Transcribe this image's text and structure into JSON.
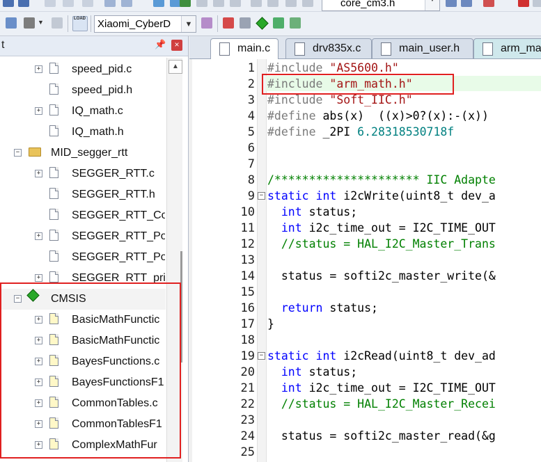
{
  "toolbar": {
    "file_combo": "core_cm3.h",
    "target_combo": "Xiaomi_CyberD",
    "load_label": "LOAD"
  },
  "panel": {
    "title": "t",
    "items": [
      {
        "label": "speed_pid.c",
        "kind": "file",
        "expandable": true
      },
      {
        "label": "speed_pid.h",
        "kind": "file",
        "expandable": false
      },
      {
        "label": "IQ_math.c",
        "kind": "file",
        "expandable": true
      },
      {
        "label": "IQ_math.h",
        "kind": "file",
        "expandable": false
      },
      {
        "label": "MID_segger_rtt",
        "kind": "folder",
        "expandable": true
      },
      {
        "label": "SEGGER_RTT.c",
        "kind": "file",
        "expandable": true
      },
      {
        "label": "SEGGER_RTT.h",
        "kind": "file",
        "expandable": false
      },
      {
        "label": "SEGGER_RTT_Con",
        "kind": "file",
        "expandable": false
      },
      {
        "label": "SEGGER_RTT_Port",
        "kind": "file",
        "expandable": true
      },
      {
        "label": "SEGGER_RTT_Port",
        "kind": "file",
        "expandable": false
      },
      {
        "label": "SEGGER_RTT_prin",
        "kind": "file",
        "expandable": true
      },
      {
        "label": "CMSIS",
        "kind": "component",
        "expandable": true
      },
      {
        "label": "BasicMathFunctic",
        "kind": "lib",
        "expandable": true
      },
      {
        "label": "BasicMathFunctic",
        "kind": "lib",
        "expandable": true
      },
      {
        "label": "BayesFunctions.c",
        "kind": "lib",
        "expandable": true
      },
      {
        "label": "BayesFunctionsF1",
        "kind": "lib",
        "expandable": true
      },
      {
        "label": "CommonTables.c",
        "kind": "lib",
        "expandable": true
      },
      {
        "label": "CommonTablesF1",
        "kind": "lib",
        "expandable": true
      },
      {
        "label": "ComplexMathFur",
        "kind": "lib",
        "expandable": true
      }
    ]
  },
  "tabs": [
    {
      "label": "main.c",
      "active": true
    },
    {
      "label": "drv835x.c",
      "active": false
    },
    {
      "label": "main_user.h",
      "active": false
    },
    {
      "label": "arm_ma",
      "active": false
    }
  ],
  "editor": {
    "line_numbers": [
      "1",
      "2",
      "3",
      "4",
      "5",
      "6",
      "7",
      "8",
      "9",
      "10",
      "11",
      "12",
      "13",
      "14",
      "15",
      "16",
      "17",
      "18",
      "19",
      "20",
      "21",
      "22",
      "23",
      "24",
      "25"
    ],
    "lines": {
      "l1": {
        "pp": "#include",
        "str": "\"AS5600.h\""
      },
      "l2": {
        "pp": "#include",
        "str": "\"arm_math.h\""
      },
      "l3": {
        "pp": "#include",
        "str": "\"Soft_IIC.h\""
      },
      "l4": {
        "pp": "#define",
        "rest": "abs(x)  ((x)>0?(x):-(x))"
      },
      "l5": {
        "pp": "#define",
        "rest1": "_2PI",
        "num": "6.28318530718f"
      },
      "l8": {
        "comment": "/********************* IIC Adapte"
      },
      "l9": {
        "kw1": "static",
        "kw2": "int",
        "rest": "i2cWrite(uint8_t dev_a"
      },
      "l10": {
        "kw": "int",
        "rest": "status;"
      },
      "l11": {
        "kw": "int",
        "rest": "i2c_time_out = I2C_TIME_OUT"
      },
      "l12": {
        "comment": "//status = HAL_I2C_Master_Trans"
      },
      "l14": {
        "rest": "status = softi2c_master_write(&"
      },
      "l16": {
        "kw": "return",
        "rest": "status;"
      },
      "l17": {
        "rest": "}"
      },
      "l19": {
        "kw1": "static",
        "kw2": "int",
        "rest": "i2cRead(uint8_t dev_ad"
      },
      "l20": {
        "kw": "int",
        "rest": "status;"
      },
      "l21": {
        "kw": "int",
        "rest": "i2c_time_out = I2C_TIME_OUT"
      },
      "l22": {
        "comment": "//status = HAL_I2C_Master_Recei"
      },
      "l24": {
        "rest": "status = softi2c_master_read(&g"
      }
    }
  },
  "colors": {
    "highlight": "#e02020",
    "keyword": "#0000ff",
    "string": "#a31515",
    "comment": "#008000",
    "preprocessor": "#7a7a7a",
    "number": "#008080"
  }
}
